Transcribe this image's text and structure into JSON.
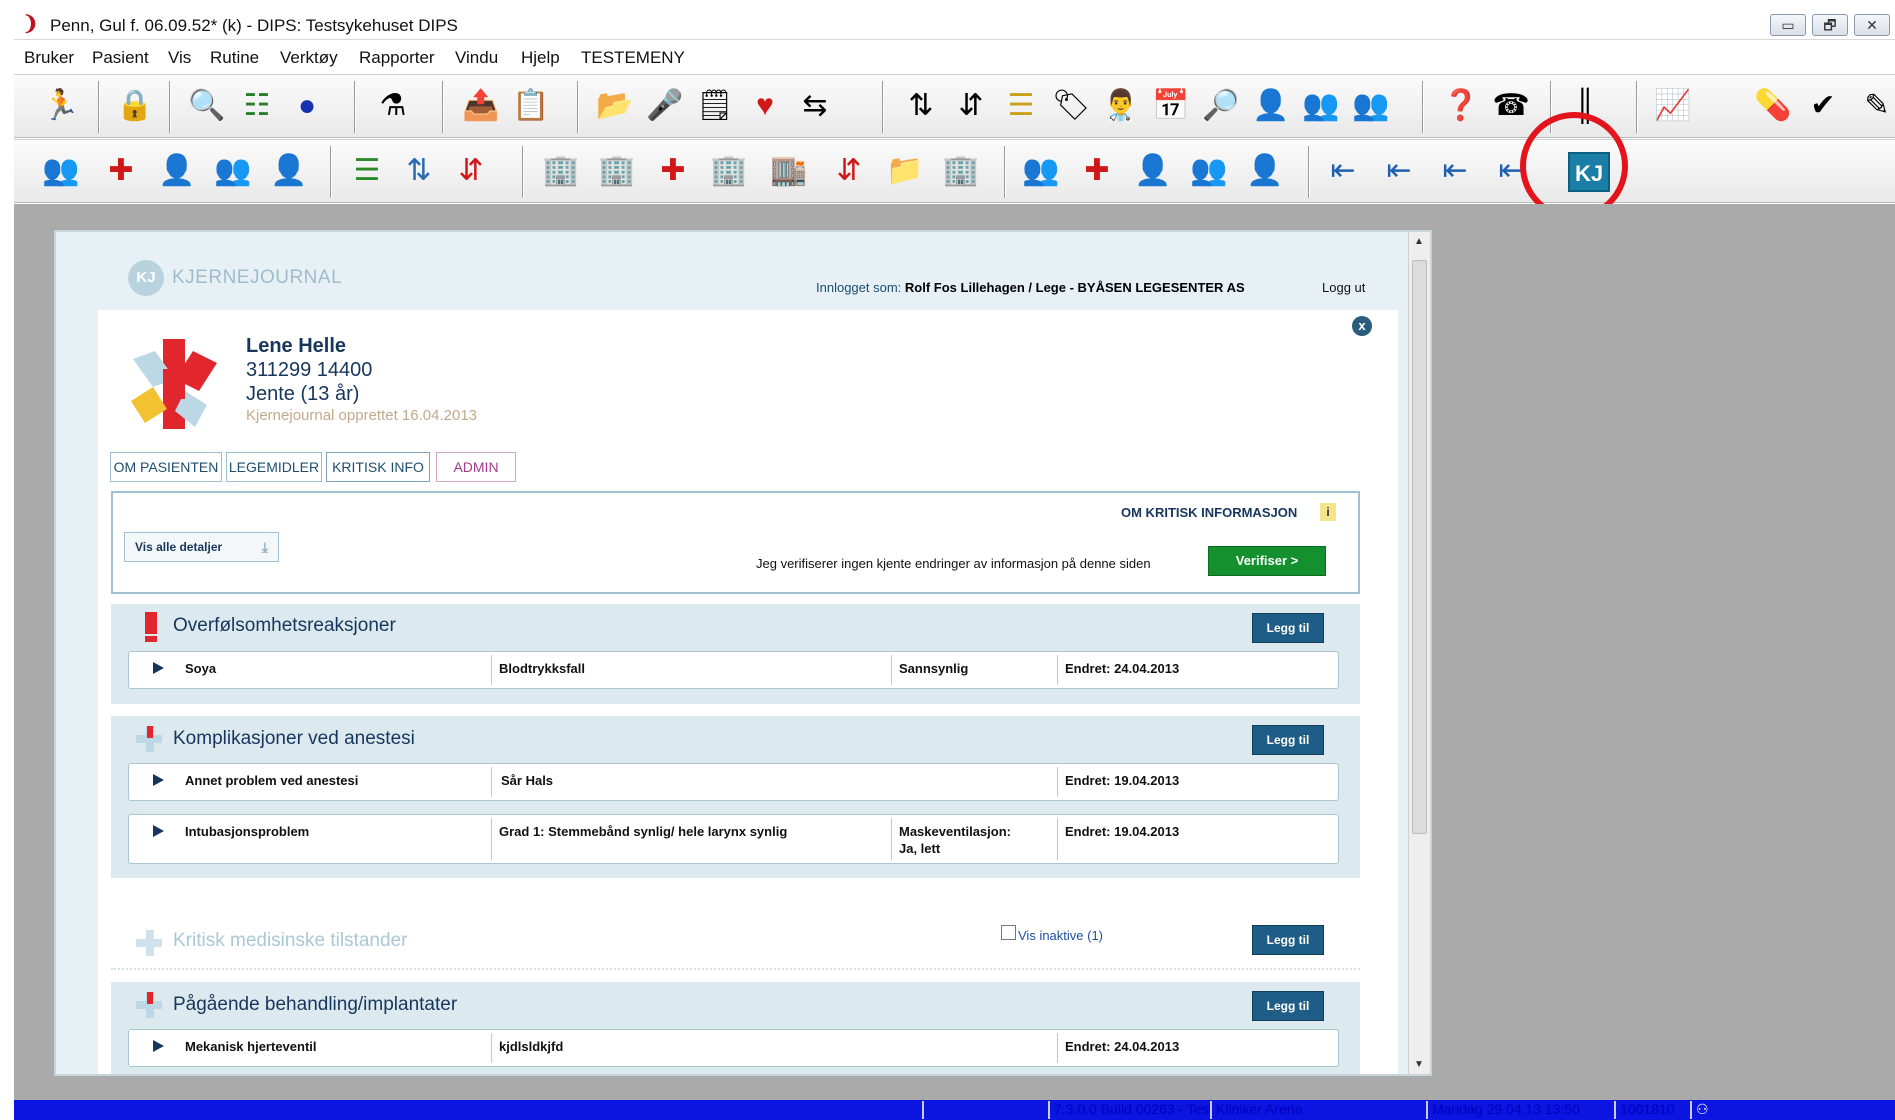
{
  "window": {
    "title": "Penn, Gul f. 06.09.52* (k) - DIPS: Testsykehuset DIPS",
    "controls": [
      "▭",
      "🗗",
      "✕"
    ]
  },
  "menubar": {
    "items": [
      "Bruker",
      "Pasient",
      "Vis",
      "Rutine",
      "Verktøy",
      "Rapporter",
      "Vindu",
      "Hjelp",
      "TESTEMENY"
    ]
  },
  "toolbar": {
    "kj_button_label": "KJ"
  },
  "statusbar": {
    "cells": [
      "7.3.0.0 Build 00263 - Test",
      "Kliniker Arena",
      "Mandag 29.04.13 13:50",
      "1001810"
    ]
  },
  "kj": {
    "logo_mark": "KJ",
    "logo_text": "KJERNEJOURNAL",
    "login_label": "Innlogget som:",
    "login_user": "Rolf Fos Lillehagen / Lege - BYÅSEN LEGESENTER AS",
    "logout": "Logg ut",
    "close": "x"
  },
  "patient": {
    "name": "Lene Helle",
    "id": "311299 14400",
    "sex_age": "Jente (13 år)",
    "created": "Kjernejournal opprettet 16.04.2013"
  },
  "tabs": [
    "OM PASIENTEN",
    "LEGEMIDLER",
    "KRITISK INFO",
    "ADMIN"
  ],
  "info": {
    "heading": "OM KRITISK INFORMASJON",
    "icon": "i",
    "details_button": "Vis alle detaljer",
    "verify_text": "Jeg verifiserer ingen kjente endringer av informasjon på denne siden",
    "verify_button": "Verifiser  >"
  },
  "sections": {
    "s1": {
      "title": "Overfølsomhetsreaksjoner",
      "button": "Legg til",
      "rows": [
        {
          "c1": "Soya",
          "c2": "Blodtrykksfall",
          "c3": "Sannsynlig",
          "c4": "Endret: 24.04.2013"
        }
      ]
    },
    "s2": {
      "title": "Komplikasjoner ved anestesi",
      "button": "Legg til",
      "rows": [
        {
          "c1": "Annet problem ved anestesi",
          "c2": "Sår Hals",
          "c3": "",
          "c4": "Endret: 19.04.2013"
        },
        {
          "c1": "Intubasjonsproblem",
          "c2": "Grad 1: Stemmebånd synlig/ hele larynx synlig",
          "c3": "Maskeventilasjon:",
          "c3b": "Ja, lett",
          "c4": "Endret: 19.04.2013"
        }
      ]
    },
    "s3": {
      "title": "Kritisk medisinske tilstander",
      "inactive": "Vis inaktive (1)",
      "button": "Legg til"
    },
    "s4": {
      "title": "Pågående behandling/implantater",
      "button": "Legg til",
      "rows": [
        {
          "c1": "Mekanisk hjerteventil",
          "c2": "kjdlsldkjfd",
          "c4": "Endret: 24.04.2013"
        }
      ]
    }
  }
}
